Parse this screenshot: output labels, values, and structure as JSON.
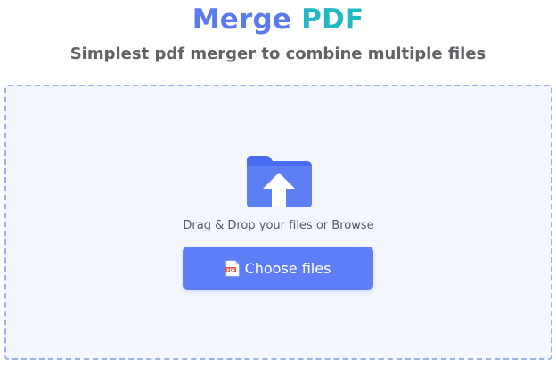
{
  "header": {
    "title_word1": "Merge",
    "title_word2": "PDF",
    "subtitle": "Simplest pdf merger to combine multiple files"
  },
  "dropzone": {
    "icon": "folder-upload-icon",
    "instruction": "Drag & Drop your files or Browse",
    "button_label": "Choose files",
    "button_icon": "pdf-file-icon"
  },
  "colors": {
    "title_primary": "#5b7bed",
    "title_accent": "#22b8c4",
    "button": "#5e7ef8",
    "dropzone_bg": "#f3f6fe",
    "dropzone_border": "#9bb2e8"
  }
}
